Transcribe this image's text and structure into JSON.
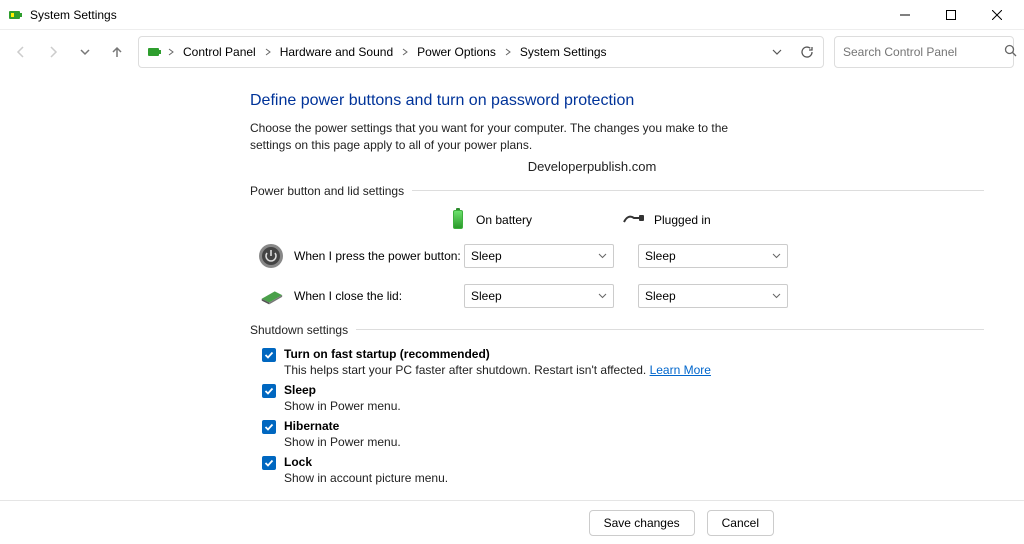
{
  "window": {
    "title": "System Settings"
  },
  "breadcrumb": {
    "items": [
      "Control Panel",
      "Hardware and Sound",
      "Power Options",
      "System Settings"
    ]
  },
  "search": {
    "placeholder": "Search Control Panel"
  },
  "page": {
    "heading": "Define power buttons and turn on password protection",
    "description": "Choose the power settings that you want for your computer. The changes you make to the settings on this page apply to all of your power plans.",
    "watermark": "Developerpublish.com"
  },
  "groups": {
    "power_lid": {
      "legend": "Power button and lid settings",
      "on_battery_label": "On battery",
      "plugged_in_label": "Plugged in",
      "rows": [
        {
          "label": "When I press the power button:",
          "battery": "Sleep",
          "plugged": "Sleep"
        },
        {
          "label": "When I close the lid:",
          "battery": "Sleep",
          "plugged": "Sleep"
        }
      ]
    },
    "shutdown": {
      "legend": "Shutdown settings",
      "items": [
        {
          "title": "Turn on fast startup (recommended)",
          "sub_prefix": "This helps start your PC faster after shutdown. Restart isn't affected. ",
          "link": "Learn More",
          "checked": true
        },
        {
          "title": "Sleep",
          "sub": "Show in Power menu.",
          "checked": true
        },
        {
          "title": "Hibernate",
          "sub": "Show in Power menu.",
          "checked": true
        },
        {
          "title": "Lock",
          "sub": "Show in account picture menu.",
          "checked": true
        }
      ]
    }
  },
  "footer": {
    "save": "Save changes",
    "cancel": "Cancel"
  }
}
